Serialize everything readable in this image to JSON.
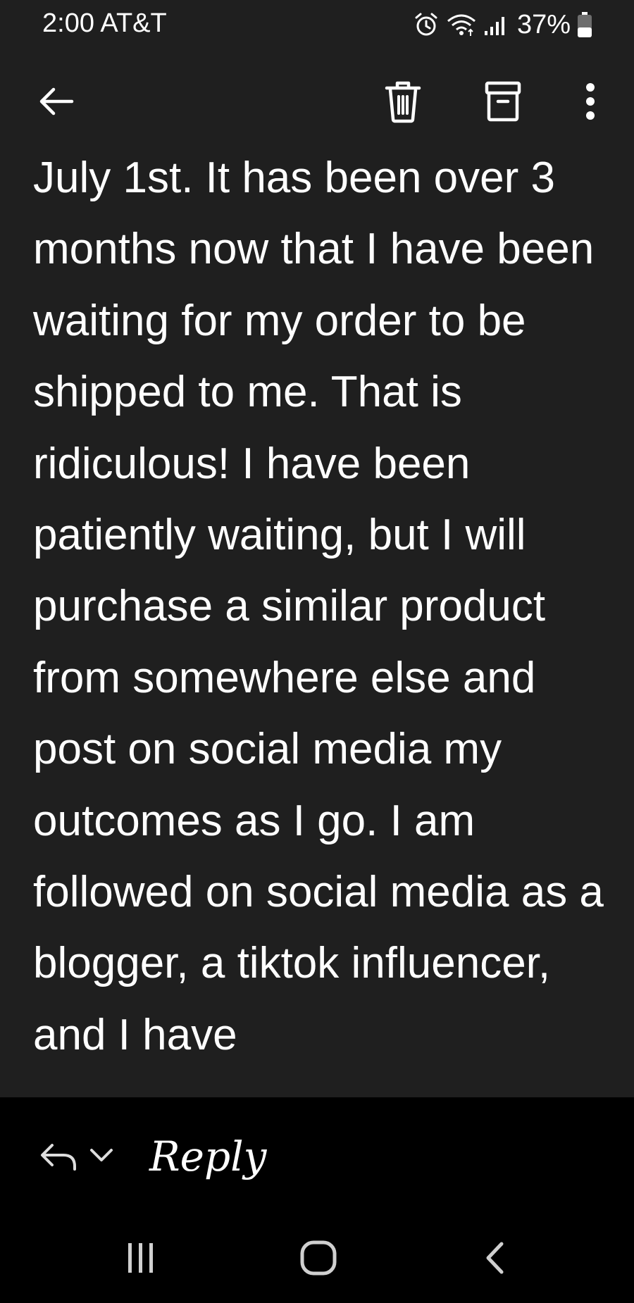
{
  "status_bar": {
    "time_carrier": "2:00 AT&T",
    "battery_percent": "37%",
    "icons": [
      "alarm-icon",
      "wifi-icon",
      "signal-icon",
      "battery-icon"
    ]
  },
  "toolbar": {
    "icons": [
      "back-arrow-icon",
      "trash-icon",
      "archive-icon",
      "more-vert-icon"
    ]
  },
  "message": {
    "body": "July 1st. It has been over 3 months now that I have been waiting for my order to be shipped to me. That is ridiculous! I have been patiently waiting, but I will purchase a similar product from somewhere else and post on social media my outcomes as I go. I am followed on social media as a blogger, a tiktok influencer, and I have"
  },
  "reply_bar": {
    "label": "Reply",
    "icons": [
      "reply-icon",
      "chevron-down-icon"
    ]
  },
  "nav_bar": {
    "icons": [
      "recent-apps-icon",
      "home-icon",
      "back-nav-icon"
    ]
  },
  "colors": {
    "surface": "#1f1f1f",
    "background": "#000000",
    "text": "#ffffff",
    "icon": "#ffffff",
    "nav_icon": "#d0d0d0"
  }
}
